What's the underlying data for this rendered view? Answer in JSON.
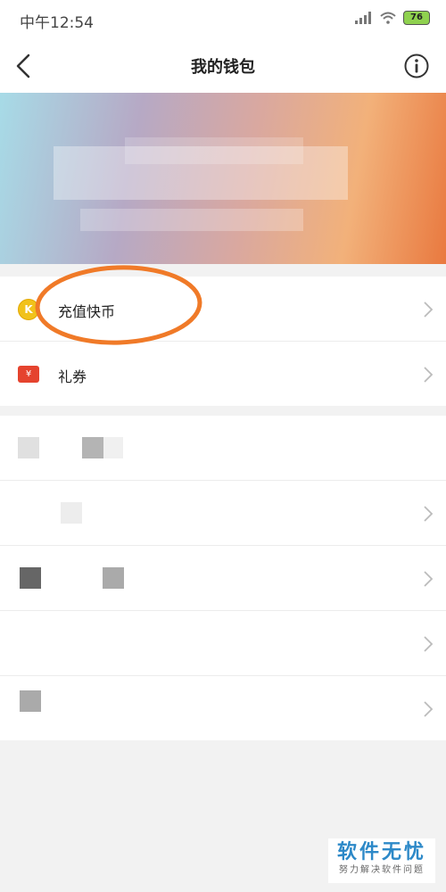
{
  "status_bar": {
    "time": "中午12:54",
    "battery": "76"
  },
  "nav": {
    "title": "我的钱包"
  },
  "menu1": [
    {
      "label": "充值快币",
      "icon": "kuaibi-coin-icon"
    },
    {
      "label": "礼券",
      "icon": "coupon-icon"
    }
  ],
  "menu2_rows": 5,
  "watermark": {
    "line1": "软件无忧",
    "line2": "努力解决软件问题"
  },
  "colors": {
    "accent_orange": "#f07a28",
    "coin_gold": "#f1c21b",
    "coupon_red": "#e5432e",
    "watermark_blue": "#2d89c8"
  }
}
